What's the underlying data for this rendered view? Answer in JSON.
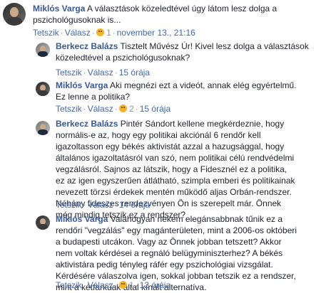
{
  "comments": [
    {
      "author": "Miklós Varga",
      "text": "A választások közeledtével úgy látom lesz dolga a pszichológusoknak is...",
      "like": "Tetszik",
      "reply": "Válasz",
      "reactions": "1",
      "time": "november 13., 21:16"
    },
    {
      "author": "Berkecz Balázs",
      "text": "Tisztelt Művész Úr! Kivel lesz dolga a választások közeledtével a pszichológusoknak?",
      "like": "Tetszik",
      "reply": "Válasz",
      "time": "15 órája"
    },
    {
      "author": "Miklós Varga",
      "text": "Aki megnézi ezt a videót, annak elég egyértelmű. Ez lenne a politika?",
      "like": "Tetszik",
      "reply": "Válasz",
      "reactions": "2",
      "time": "15 órája"
    },
    {
      "author": "Berkecz Balázs",
      "text": "Pintér Sándort kellene megkérdeznie, hogy normális-e az, hogy egy politikai akciónál 6 rendőr kell igazoltasson egy békés aktivistát azzal a hazugsággal, hogy általános igazoltatásról van szó, nem politikai célú rendvédelmi vegzálásról. Sajnos az látszik, hogy a Fidesznél ez a politika, ez az igen egyszerűen átlátható, szimpla emberi és politikainak nevezett törzsi érdekek mentén működő aljas Orbán-rendszer. Néhány fideszes rendezvényen Ön is szerepelt már. Önnek még mindig tetszik ez a rendszer?",
      "like": "Tetszik",
      "reply": "Válasz",
      "time": "14 órája"
    },
    {
      "author": "Miklós Varga",
      "text": "Valahogyan nekem elegánsabbnak tűnik ez a rendőri \"vegzálás\" egy magánterületen, mint a 2006-os októberi a budapesti utcákon. Vagy az Önnek jobban tetszett? Akkor nem voltak kérdései a regnáló belügyminiszterhez? A békés aktivistára pedig tényleg ráfér egy pszichológiai vizsgálat. Kérdésére válaszolva igen, sokkal jobban tetszik ez a rendszer, mint a kétfarkúak által kínált alternatíva.",
      "like": "Tetszik",
      "reply": "Válasz",
      "reactions": "1",
      "time": "12 órája"
    }
  ]
}
